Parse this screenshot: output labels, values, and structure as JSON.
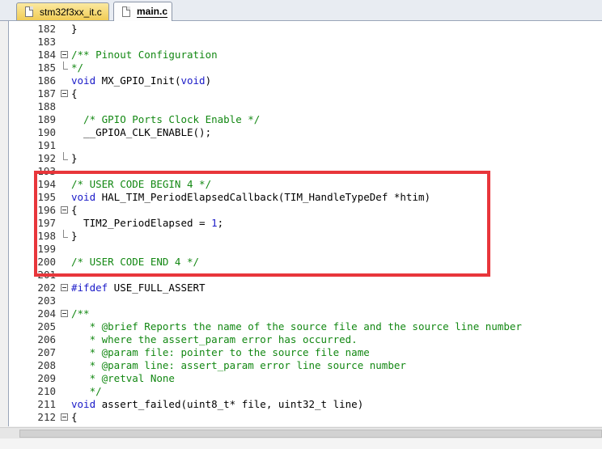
{
  "tabs": [
    {
      "label": "stm32f3xx_it.c",
      "active": false
    },
    {
      "label": "main.c",
      "active": true
    }
  ],
  "colors": {
    "comment": "#138813",
    "keyword": "#1a1ac8",
    "highlight_box": "#e8363b"
  },
  "lines": [
    {
      "num": "182",
      "fold": "none",
      "parts": [
        {
          "t": "}",
          "c": "text"
        }
      ]
    },
    {
      "num": "183",
      "fold": "none",
      "parts": []
    },
    {
      "num": "184",
      "fold": "open",
      "parts": [
        {
          "t": "/** Pinout Configuration",
          "c": "comment"
        }
      ]
    },
    {
      "num": "185",
      "fold": "end",
      "parts": [
        {
          "t": "*/",
          "c": "comment"
        }
      ]
    },
    {
      "num": "186",
      "fold": "none",
      "parts": [
        {
          "t": "void",
          "c": "kw"
        },
        {
          "t": " MX_GPIO_Init(",
          "c": "text"
        },
        {
          "t": "void",
          "c": "kw"
        },
        {
          "t": ")",
          "c": "text"
        }
      ]
    },
    {
      "num": "187",
      "fold": "open",
      "parts": [
        {
          "t": "{",
          "c": "text"
        }
      ]
    },
    {
      "num": "188",
      "fold": "none",
      "parts": []
    },
    {
      "num": "189",
      "fold": "none",
      "parts": [
        {
          "t": "  /* GPIO Ports Clock Enable */",
          "c": "comment"
        }
      ]
    },
    {
      "num": "190",
      "fold": "none",
      "parts": [
        {
          "t": "  __GPIOA_CLK_ENABLE();",
          "c": "text"
        }
      ]
    },
    {
      "num": "191",
      "fold": "none",
      "parts": []
    },
    {
      "num": "192",
      "fold": "end",
      "parts": [
        {
          "t": "}",
          "c": "text"
        }
      ]
    },
    {
      "num": "193",
      "fold": "none",
      "parts": []
    },
    {
      "num": "194",
      "fold": "none",
      "parts": [
        {
          "t": "/* USER CODE BEGIN 4 */",
          "c": "comment"
        }
      ]
    },
    {
      "num": "195",
      "fold": "none",
      "parts": [
        {
          "t": "void",
          "c": "kw"
        },
        {
          "t": " HAL_TIM_PeriodElapsedCallback(TIM_HandleTypeDef *htim)",
          "c": "text"
        }
      ]
    },
    {
      "num": "196",
      "fold": "open",
      "parts": [
        {
          "t": "{",
          "c": "text"
        }
      ]
    },
    {
      "num": "197",
      "fold": "none",
      "parts": [
        {
          "t": "  TIM2_PeriodElapsed = ",
          "c": "text"
        },
        {
          "t": "1",
          "c": "kw"
        },
        {
          "t": ";",
          "c": "text"
        }
      ]
    },
    {
      "num": "198",
      "fold": "end",
      "parts": [
        {
          "t": "}",
          "c": "text"
        }
      ]
    },
    {
      "num": "199",
      "fold": "none",
      "parts": []
    },
    {
      "num": "200",
      "fold": "none",
      "parts": [
        {
          "t": "/* USER CODE END 4 */",
          "c": "comment"
        }
      ]
    },
    {
      "num": "201",
      "fold": "none",
      "parts": []
    },
    {
      "num": "202",
      "fold": "open",
      "parts": [
        {
          "t": "#ifdef",
          "c": "kw"
        },
        {
          "t": " USE_FULL_ASSERT",
          "c": "text"
        }
      ]
    },
    {
      "num": "203",
      "fold": "none",
      "parts": []
    },
    {
      "num": "204",
      "fold": "open",
      "parts": [
        {
          "t": "/**",
          "c": "comment"
        }
      ]
    },
    {
      "num": "205",
      "fold": "none",
      "parts": [
        {
          "t": "   * @brief Reports the name of the source file and the source line number",
          "c": "comment"
        }
      ]
    },
    {
      "num": "206",
      "fold": "none",
      "parts": [
        {
          "t": "   * where the assert_param error has occurred.",
          "c": "comment"
        }
      ]
    },
    {
      "num": "207",
      "fold": "none",
      "parts": [
        {
          "t": "   * @param file: pointer to the source file name",
          "c": "comment"
        }
      ]
    },
    {
      "num": "208",
      "fold": "none",
      "parts": [
        {
          "t": "   * @param line: assert_param error line source number",
          "c": "comment"
        }
      ]
    },
    {
      "num": "209",
      "fold": "none",
      "parts": [
        {
          "t": "   * @retval None",
          "c": "comment"
        }
      ]
    },
    {
      "num": "210",
      "fold": "none",
      "parts": [
        {
          "t": "   */",
          "c": "comment"
        }
      ]
    },
    {
      "num": "211",
      "fold": "none",
      "parts": [
        {
          "t": "void",
          "c": "kw"
        },
        {
          "t": " assert_failed(uint8_t* file, uint32_t line)",
          "c": "text"
        }
      ]
    },
    {
      "num": "212",
      "fold": "open",
      "parts": [
        {
          "t": "{",
          "c": "text"
        }
      ]
    }
  ]
}
